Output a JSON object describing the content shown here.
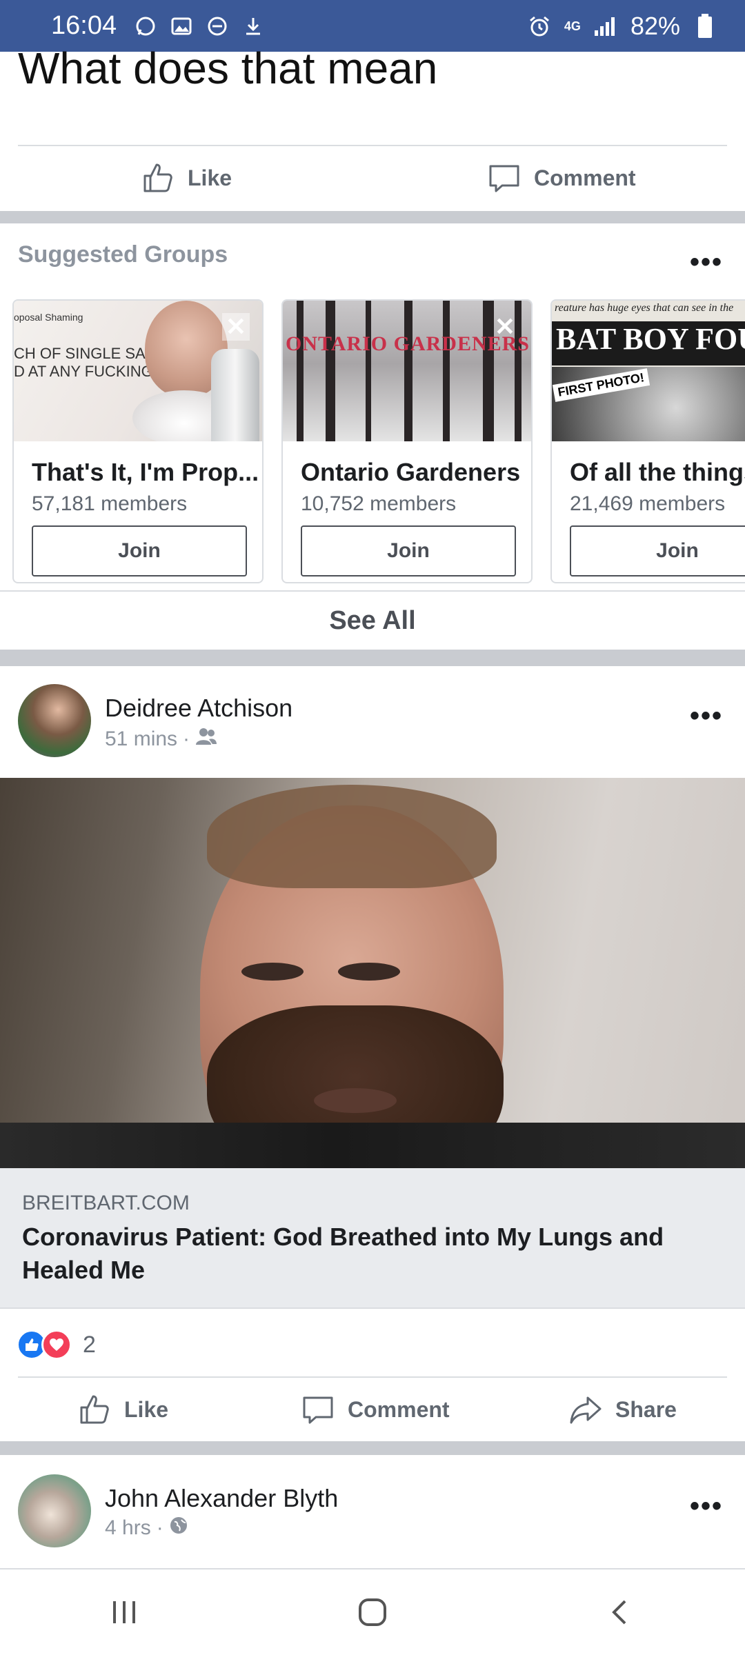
{
  "status_bar": {
    "time": "16:04",
    "network": "4G",
    "battery": "82%",
    "icons": [
      "whatsapp-icon",
      "image-icon",
      "do-not-disturb-icon",
      "download-icon",
      "alarm-icon",
      "signal-icon",
      "battery-icon"
    ]
  },
  "top_post": {
    "text": "What does that mean",
    "actions": {
      "like": "Like",
      "comment": "Comment"
    }
  },
  "suggested_groups": {
    "title": "Suggested Groups",
    "more": "•••",
    "groups": [
      {
        "name": "That's It, I'm Prop...",
        "members": "57,181 members",
        "join": "Join",
        "thumb_lines": [
          "oposal Shaming",
          "CH OF SINGLE SALTY",
          "D AT ANY FUCKING"
        ]
      },
      {
        "name": "Ontario Gardeners",
        "members": "10,752 members",
        "join": "Join",
        "thumb_lines": [
          "ONTARIO GARDENERS"
        ]
      },
      {
        "name": "Of all the things",
        "members": "21,469 members",
        "join": "Join",
        "thumb_lines": [
          "reature has huge eyes that can see in the",
          "BAT BOY FOUND",
          "FIRST PHOTO!"
        ]
      }
    ],
    "see_all": "See All"
  },
  "post1": {
    "author": "Deidree Atchison",
    "time": "51 mins",
    "more": "•••",
    "link": {
      "domain": "BREITBART.COM",
      "title": "Coronavirus Patient: God Breathed into My Lungs and Healed Me"
    },
    "reaction_count": "2",
    "actions": {
      "like": "Like",
      "comment": "Comment",
      "share": "Share"
    }
  },
  "post2": {
    "author": "John Alexander Blyth",
    "time": "4 hrs",
    "more": "•••"
  },
  "colors": {
    "status_bar": "#3b5998",
    "like_blue": "#1877f2",
    "love_red": "#f33e58",
    "separator": "#c9ccd1",
    "link_box": "#e9ebee"
  }
}
